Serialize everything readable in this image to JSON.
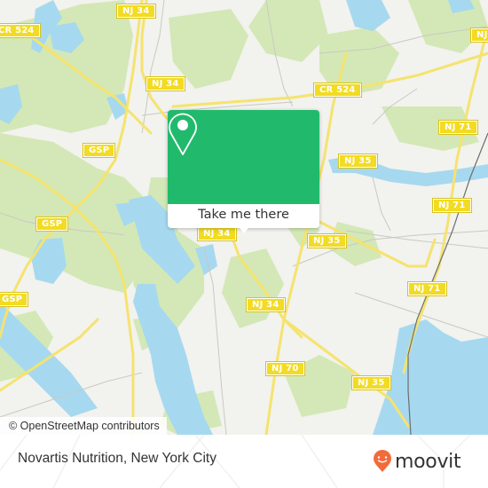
{
  "map": {
    "colors": {
      "land": "#f2f2ee",
      "park": "#d3e8b6",
      "water": "#a6d9ef",
      "road_major": "#f5e36e",
      "road_minor": "#c9c9c4",
      "rail": "#6d6d6d",
      "shield_bg": "#f2db22",
      "popup_green": "#21ba6c"
    },
    "shields": [
      {
        "label": "NJ 34"
      },
      {
        "label": "CR 524"
      },
      {
        "label": "NJ 34"
      },
      {
        "label": "CR 524"
      },
      {
        "label": "NJ"
      },
      {
        "label": "NJ 71"
      },
      {
        "label": "NJ 35"
      },
      {
        "label": "GSP"
      },
      {
        "label": "GSP"
      },
      {
        "label": "NJ 34"
      },
      {
        "label": "NJ 35"
      },
      {
        "label": "NJ 71"
      },
      {
        "label": "NJ 71"
      },
      {
        "label": "GSP"
      },
      {
        "label": "NJ 34"
      },
      {
        "label": "NJ 70"
      },
      {
        "label": "NJ 35"
      }
    ]
  },
  "popup": {
    "icon": "location-pin-icon",
    "button_label": "Take me there"
  },
  "attribution": "© OpenStreetMap contributors",
  "footer": {
    "place_name": "Novartis Nutrition, New York City",
    "logo_text": "moovit",
    "logo_icon": "moovit-smile-pin-icon",
    "logo_color": "#f26b3a"
  }
}
